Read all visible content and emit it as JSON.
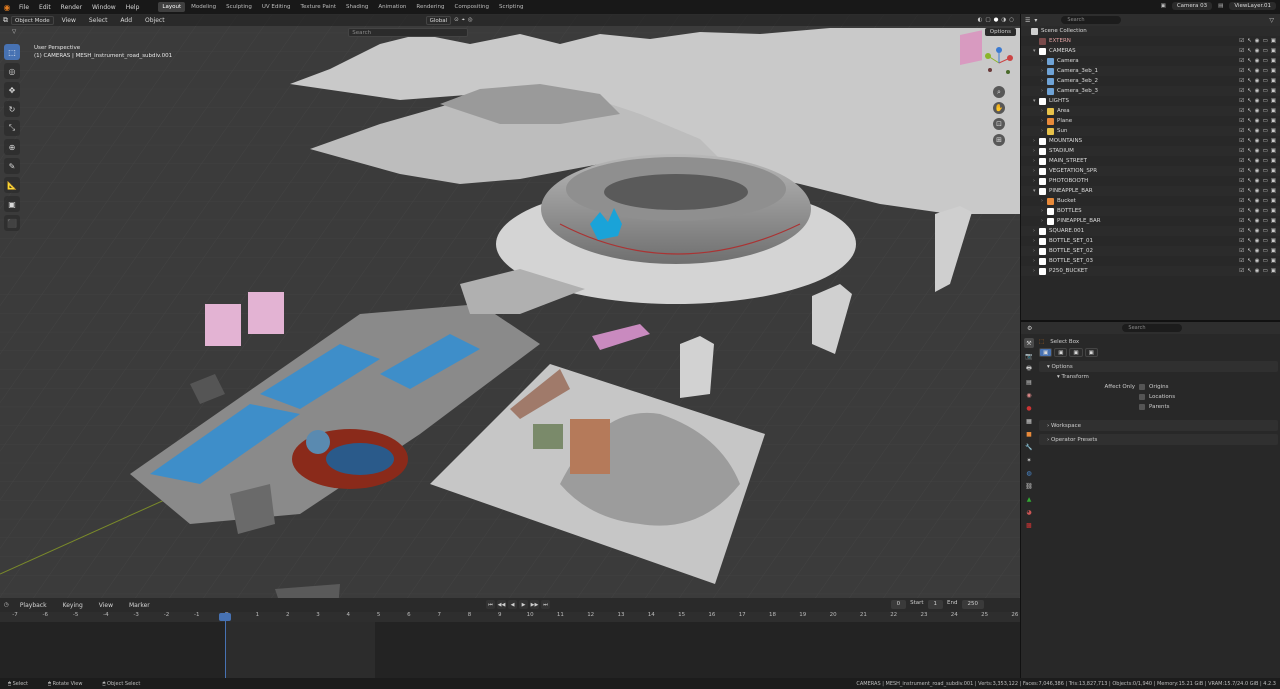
{
  "topbar": {
    "menus": [
      "File",
      "Edit",
      "Render",
      "Window",
      "Help"
    ],
    "workspaces": [
      "Layout",
      "Modeling",
      "Sculpting",
      "UV Editing",
      "Texture Paint",
      "Shading",
      "Animation",
      "Rendering",
      "Compositing",
      "Scripting"
    ],
    "active_workspace": "Layout",
    "scene": "Camera 03",
    "view_layer": "ViewLayer.01"
  },
  "viewport": {
    "mode": "Object Mode",
    "menus": [
      "View",
      "Select",
      "Add",
      "Object"
    ],
    "orientation": "Global",
    "search_placeholder": "Search",
    "options": "Options",
    "info_line1": "User Perspective",
    "info_line2": "(1) CAMERAS | MESH_instrument_road_subdiv.001"
  },
  "timeline": {
    "menus": [
      "Playback",
      "Keying",
      "View",
      "Marker"
    ],
    "current_frame": "0",
    "start_label": "Start",
    "start": "1",
    "end_label": "End",
    "end": "250",
    "ticks": [
      "-7",
      "-6",
      "-5",
      "-4",
      "-3",
      "-2",
      "-1",
      "0",
      "1",
      "2",
      "3",
      "4",
      "5",
      "6",
      "7",
      "8",
      "9",
      "10",
      "11",
      "12",
      "13",
      "14",
      "15",
      "16",
      "17",
      "18",
      "19",
      "20",
      "21",
      "22",
      "23",
      "24",
      "25",
      "26"
    ]
  },
  "status": {
    "left": [
      "Select",
      "Rotate View",
      "Object Select"
    ],
    "right": "CAMERAS | MESH_instrument_road_subdiv.001 | Verts:3,353,122 | Faces:7,046,386 | Tris:13,827,713 | Objects:0/1,940 | Memory:15.21 GiB | VRAM:15.7/24.0 GiB | 4.2.3"
  },
  "outliner": {
    "search_placeholder": "Search",
    "rows": [
      {
        "label": "Scene Collection",
        "indent": 0,
        "color": "#dcdcdc",
        "icon": "#cfcfcf",
        "arrow": ""
      },
      {
        "label": "EXTERN",
        "indent": 1,
        "color": "#e3a3a3",
        "icon": "#7a4b4b",
        "arrow": ""
      },
      {
        "label": "CAMERAS",
        "indent": 1,
        "color": "#dcdcdc",
        "icon": "#ffffff",
        "arrow": "▾"
      },
      {
        "label": "Camera",
        "indent": 2,
        "color": "#dcdcdc",
        "icon": "#6fa3d6",
        "arrow": "›"
      },
      {
        "label": "Camera_3eb_1",
        "indent": 2,
        "color": "#dcdcdc",
        "icon": "#6fa3d6",
        "arrow": "›"
      },
      {
        "label": "Camera_3eb_2",
        "indent": 2,
        "color": "#dcdcdc",
        "icon": "#6fa3d6",
        "arrow": "›"
      },
      {
        "label": "Camera_3eb_3",
        "indent": 2,
        "color": "#dcdcdc",
        "icon": "#6fa3d6",
        "arrow": "›"
      },
      {
        "label": "LIGHTS",
        "indent": 1,
        "color": "#dcdcdc",
        "icon": "#ffffff",
        "arrow": "▾"
      },
      {
        "label": "Area",
        "indent": 2,
        "color": "#dcdcdc",
        "icon": "#e8c24a",
        "arrow": "›"
      },
      {
        "label": "Plane",
        "indent": 2,
        "color": "#dcdcdc",
        "icon": "#e88a3a",
        "arrow": "›"
      },
      {
        "label": "Sun",
        "indent": 2,
        "color": "#dcdcdc",
        "icon": "#e8c24a",
        "arrow": "›"
      },
      {
        "label": "MOUNTAINS",
        "indent": 1,
        "color": "#dcdcdc",
        "icon": "#ffffff",
        "arrow": "›"
      },
      {
        "label": "STADIUM",
        "indent": 1,
        "color": "#dcdcdc",
        "icon": "#ffffff",
        "arrow": "›"
      },
      {
        "label": "MAIN_STREET",
        "indent": 1,
        "color": "#dcdcdc",
        "icon": "#ffffff",
        "arrow": "›"
      },
      {
        "label": "VEGETATION_SPR",
        "indent": 1,
        "color": "#dcdcdc",
        "icon": "#ffffff",
        "arrow": "›"
      },
      {
        "label": "PHOTOBOOTH",
        "indent": 1,
        "color": "#dcdcdc",
        "icon": "#ffffff",
        "arrow": "›"
      },
      {
        "label": "PINEAPPLE_BAR",
        "indent": 1,
        "color": "#dcdcdc",
        "icon": "#ffffff",
        "arrow": "▾"
      },
      {
        "label": "Bucket",
        "indent": 2,
        "color": "#dcdcdc",
        "icon": "#e88a3a",
        "arrow": "›"
      },
      {
        "label": "BOTTLES",
        "indent": 2,
        "color": "#dcdcdc",
        "icon": "#ffffff",
        "arrow": "›"
      },
      {
        "label": "PINEAPPLE_BAR",
        "indent": 2,
        "color": "#dcdcdc",
        "icon": "#ffffff",
        "arrow": "›"
      },
      {
        "label": "SQUARE.001",
        "indent": 1,
        "color": "#dcdcdc",
        "icon": "#ffffff",
        "arrow": "›"
      },
      {
        "label": "BOTTLE_SET_01",
        "indent": 1,
        "color": "#dcdcdc",
        "icon": "#ffffff",
        "arrow": "›"
      },
      {
        "label": "BOTTLE_SET_02",
        "indent": 1,
        "color": "#dcdcdc",
        "icon": "#ffffff",
        "arrow": "›"
      },
      {
        "label": "BOTTLE_SET_03",
        "indent": 1,
        "color": "#dcdcdc",
        "icon": "#ffffff",
        "arrow": "›"
      },
      {
        "label": "P250_BUCKET",
        "indent": 1,
        "color": "#dcdcdc",
        "icon": "#ffffff",
        "arrow": "›"
      }
    ]
  },
  "properties": {
    "search_placeholder": "Search",
    "tool_name": "Select Box",
    "options": "Options",
    "transform": "Transform",
    "affect_only": "Affect Only",
    "checkboxes": [
      "Origins",
      "Locations",
      "Parents"
    ],
    "workspace": "Workspace",
    "overlay": "Operator Presets"
  }
}
